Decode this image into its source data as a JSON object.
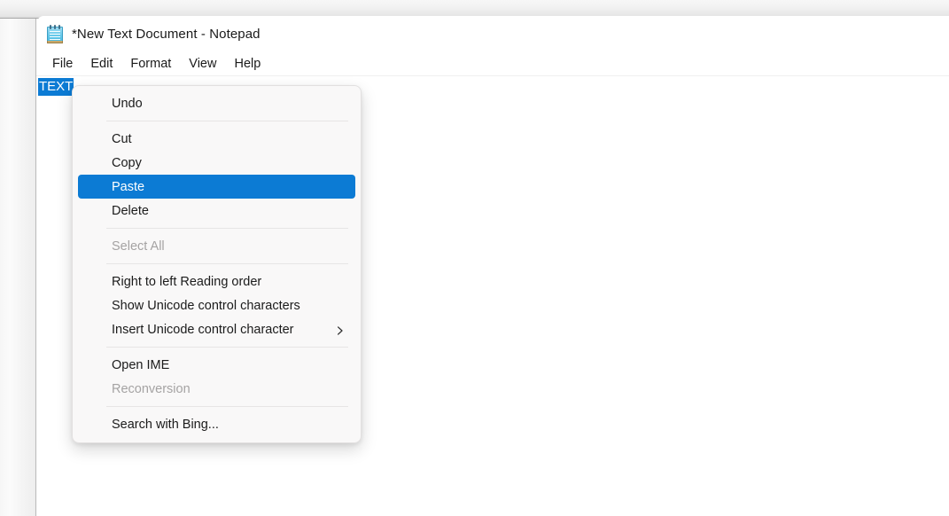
{
  "window": {
    "title": "*New Text Document - Notepad",
    "icon": "notepad-icon"
  },
  "menubar": {
    "items": [
      {
        "label": "File"
      },
      {
        "label": "Edit"
      },
      {
        "label": "Format"
      },
      {
        "label": "View"
      },
      {
        "label": "Help"
      }
    ]
  },
  "editor": {
    "selected_text": "TEXT",
    "selection_color": "#0c7bd4",
    "selection_text_color": "#ffffff"
  },
  "context_menu": {
    "highlight_color": "#0c7bd4",
    "background": "#f9f8f8",
    "groups": [
      {
        "items": [
          {
            "label": "Undo",
            "state": "enabled",
            "submenu": false
          }
        ]
      },
      {
        "items": [
          {
            "label": "Cut",
            "state": "enabled",
            "submenu": false
          },
          {
            "label": "Copy",
            "state": "enabled",
            "submenu": false
          },
          {
            "label": "Paste",
            "state": "selected",
            "submenu": false
          },
          {
            "label": "Delete",
            "state": "enabled",
            "submenu": false
          }
        ]
      },
      {
        "items": [
          {
            "label": "Select All",
            "state": "disabled",
            "submenu": false
          }
        ]
      },
      {
        "items": [
          {
            "label": "Right to left Reading order",
            "state": "enabled",
            "submenu": false
          },
          {
            "label": "Show Unicode control characters",
            "state": "enabled",
            "submenu": false
          },
          {
            "label": "Insert Unicode control character",
            "state": "enabled",
            "submenu": true
          }
        ]
      },
      {
        "items": [
          {
            "label": "Open IME",
            "state": "enabled",
            "submenu": false
          },
          {
            "label": "Reconversion",
            "state": "disabled",
            "submenu": false
          }
        ]
      },
      {
        "items": [
          {
            "label": "Search with Bing...",
            "state": "enabled",
            "submenu": false
          }
        ]
      }
    ]
  }
}
